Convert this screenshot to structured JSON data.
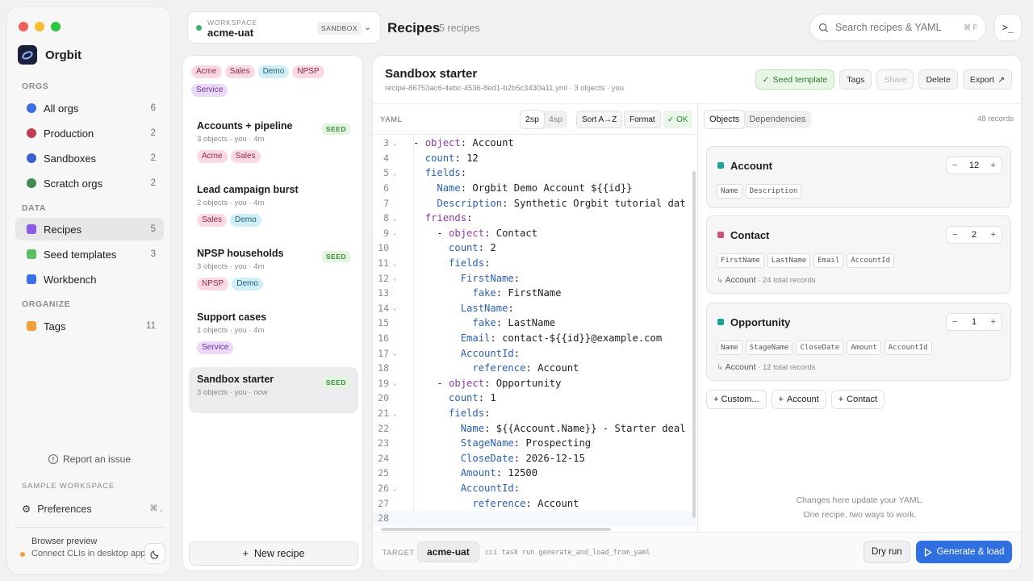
{
  "app": {
    "name": "Orgbit",
    "traffic_colors": [
      "#ef5f57",
      "#f8bd2e",
      "#2ac840"
    ]
  },
  "sidebar": {
    "orgs_label": "ORGS",
    "orgs": [
      {
        "label": "All orgs",
        "count": "6",
        "color": "#3a6fe0"
      },
      {
        "label": "Production",
        "count": "2",
        "color": "#c23b4f"
      },
      {
        "label": "Sandboxes",
        "count": "2",
        "color": "#3a5fd0"
      },
      {
        "label": "Scratch orgs",
        "count": "2",
        "color": "#3f8a4f"
      }
    ],
    "data_label": "DATA",
    "data": [
      {
        "label": "Recipes",
        "count": "5",
        "color": "#8a5ae8"
      },
      {
        "label": "Seed templates",
        "count": "3",
        "color": "#5cc060"
      },
      {
        "label": "Workbench",
        "count": "",
        "color": "#3a6fe8"
      }
    ],
    "organize_label": "ORGANIZE",
    "organize": [
      {
        "label": "Tags",
        "count": "11",
        "color": "#f0a13a"
      }
    ],
    "report": "Report an issue",
    "sample_label": "SAMPLE WORKSPACE",
    "preferences": "Preferences",
    "preferences_kbd": "⌘ ,",
    "preview_title": "Browser preview",
    "preview_text": "Connect CLIs in desktop app"
  },
  "workspace": {
    "label": "WORKSPACE",
    "name": "acme-uat",
    "badge": "SANDBOX"
  },
  "header": {
    "title": "Recipes",
    "subtitle": "5 recipes",
    "search_placeholder": "Search recipes & YAML",
    "search_kbd": "⌘ F",
    "terminal_glyph": ">_"
  },
  "filters": [
    "Acme",
    "Sales",
    "Demo",
    "NPSP",
    "Service"
  ],
  "recipes": [
    {
      "name": "Accounts + pipeline",
      "meta": "3 objects · you · 4m",
      "seed": "SEED",
      "tags": [
        "Acme",
        "Sales"
      ]
    },
    {
      "name": "Lead campaign burst",
      "meta": "2 objects · you · 4m",
      "seed": "",
      "tags": [
        "Sales",
        "Demo"
      ]
    },
    {
      "name": "NPSP households",
      "meta": "3 objects · you · 4m",
      "seed": "SEED",
      "tags": [
        "NPSP",
        "Demo"
      ]
    },
    {
      "name": "Support cases",
      "meta": "1 objects · you · 4m",
      "seed": "",
      "tags": [
        "Service"
      ]
    },
    {
      "name": "Sandbox starter",
      "meta": "3 objects · you · now",
      "seed": "SEED",
      "tags": []
    }
  ],
  "new_recipe": "New recipe",
  "editor": {
    "title": "Sandbox starter",
    "meta": "recipe-86753ac6-4ebc-4536-8ed1-b2b5c3430a11.yml · 3 objects · you",
    "actions": {
      "seed": "Seed template",
      "tags": "Tags",
      "share": "Share",
      "delete": "Delete",
      "export": "Export"
    },
    "yaml_label": "YAML",
    "indent": [
      "2sp",
      "4sp"
    ],
    "sort": "Sort A→Z",
    "format": "Format",
    "ok": "✓ OK",
    "lines": [
      {
        "n": "3",
        "fold": true,
        "indent": "",
        "dash": "- ",
        "key": "object",
        "val": "Account",
        "kw": true
      },
      {
        "n": "4",
        "fold": false,
        "indent": "  ",
        "dash": "",
        "key": "count",
        "val": "12",
        "kw": false
      },
      {
        "n": "5",
        "fold": true,
        "indent": "  ",
        "dash": "",
        "key": "fields",
        "val": "",
        "kw": false
      },
      {
        "n": "6",
        "fold": false,
        "indent": "    ",
        "dash": "",
        "key": "Name",
        "val": "Orgbit Demo Account ${{id}}",
        "kw": false
      },
      {
        "n": "7",
        "fold": false,
        "indent": "    ",
        "dash": "",
        "key": "Description",
        "val": "Synthetic Orgbit tutorial dat",
        "kw": false
      },
      {
        "n": "8",
        "fold": true,
        "indent": "  ",
        "dash": "",
        "key": "friends",
        "val": "",
        "kw": true
      },
      {
        "n": "9",
        "fold": true,
        "indent": "    ",
        "dash": "- ",
        "key": "object",
        "val": "Contact",
        "kw": true
      },
      {
        "n": "10",
        "fold": false,
        "indent": "      ",
        "dash": "",
        "key": "count",
        "val": "2",
        "kw": false
      },
      {
        "n": "11",
        "fold": true,
        "indent": "      ",
        "dash": "",
        "key": "fields",
        "val": "",
        "kw": false
      },
      {
        "n": "12",
        "fold": true,
        "indent": "        ",
        "dash": "",
        "key": "FirstName",
        "val": "",
        "kw": false
      },
      {
        "n": "13",
        "fold": false,
        "indent": "          ",
        "dash": "",
        "key": "fake",
        "val": "FirstName",
        "kw": false
      },
      {
        "n": "14",
        "fold": true,
        "indent": "        ",
        "dash": "",
        "key": "LastName",
        "val": "",
        "kw": false
      },
      {
        "n": "15",
        "fold": false,
        "indent": "          ",
        "dash": "",
        "key": "fake",
        "val": "LastName",
        "kw": false
      },
      {
        "n": "16",
        "fold": false,
        "indent": "        ",
        "dash": "",
        "key": "Email",
        "val": "contact-${{id}}@example.com",
        "kw": false
      },
      {
        "n": "17",
        "fold": true,
        "indent": "        ",
        "dash": "",
        "key": "AccountId",
        "val": "",
        "kw": false
      },
      {
        "n": "18",
        "fold": false,
        "indent": "          ",
        "dash": "",
        "key": "reference",
        "val": "Account",
        "kw": false
      },
      {
        "n": "19",
        "fold": true,
        "indent": "    ",
        "dash": "- ",
        "key": "object",
        "val": "Opportunity",
        "kw": true
      },
      {
        "n": "20",
        "fold": false,
        "indent": "      ",
        "dash": "",
        "key": "count",
        "val": "1",
        "kw": false
      },
      {
        "n": "21",
        "fold": true,
        "indent": "      ",
        "dash": "",
        "key": "fields",
        "val": "",
        "kw": false
      },
      {
        "n": "22",
        "fold": false,
        "indent": "        ",
        "dash": "",
        "key": "Name",
        "val": "${{Account.Name}} - Starter deal",
        "kw": false
      },
      {
        "n": "23",
        "fold": false,
        "indent": "        ",
        "dash": "",
        "key": "StageName",
        "val": "Prospecting",
        "kw": false
      },
      {
        "n": "24",
        "fold": false,
        "indent": "        ",
        "dash": "",
        "key": "CloseDate",
        "val": "2026-12-15",
        "kw": false
      },
      {
        "n": "25",
        "fold": false,
        "indent": "        ",
        "dash": "",
        "key": "Amount",
        "val": "12500",
        "kw": false
      },
      {
        "n": "26",
        "fold": true,
        "indent": "        ",
        "dash": "",
        "key": "AccountId",
        "val": "",
        "kw": false
      },
      {
        "n": "27",
        "fold": false,
        "indent": "          ",
        "dash": "",
        "key": "reference",
        "val": "Account",
        "kw": false
      },
      {
        "n": "28",
        "fold": false,
        "indent": "",
        "dash": "",
        "key": "",
        "val": "",
        "kw": false
      }
    ]
  },
  "objects_pane": {
    "tabs": [
      "Objects",
      "Dependencies"
    ],
    "records": "48 records",
    "objects": [
      {
        "name": "Account",
        "color": "#1aa39a",
        "count": "12",
        "fields": [
          "Name",
          "Description"
        ],
        "ref_parent": "",
        "ref_text": ""
      },
      {
        "name": "Contact",
        "color": "#d0527f",
        "count": "2",
        "fields": [
          "FirstName",
          "LastName",
          "Email",
          "AccountId"
        ],
        "ref_parent": "Account",
        "ref_text": "· 24 total records"
      },
      {
        "name": "Opportunity",
        "color": "#1aa39a",
        "count": "1",
        "fields": [
          "Name",
          "StageName",
          "CloseDate",
          "Amount",
          "AccountId"
        ],
        "ref_parent": "Account",
        "ref_text": "· 12 total records"
      }
    ],
    "add_buttons": [
      "+ Custom...",
      "Account",
      "Contact"
    ],
    "hint_1": "Changes here update your YAML.",
    "hint_2": "One recipe, two ways to work."
  },
  "bottom": {
    "target_label": "TARGET",
    "target": "acme-uat",
    "command": "cci task run generate_and_load_from_yaml",
    "dry_run": "Dry run",
    "generate": "Generate & load"
  }
}
